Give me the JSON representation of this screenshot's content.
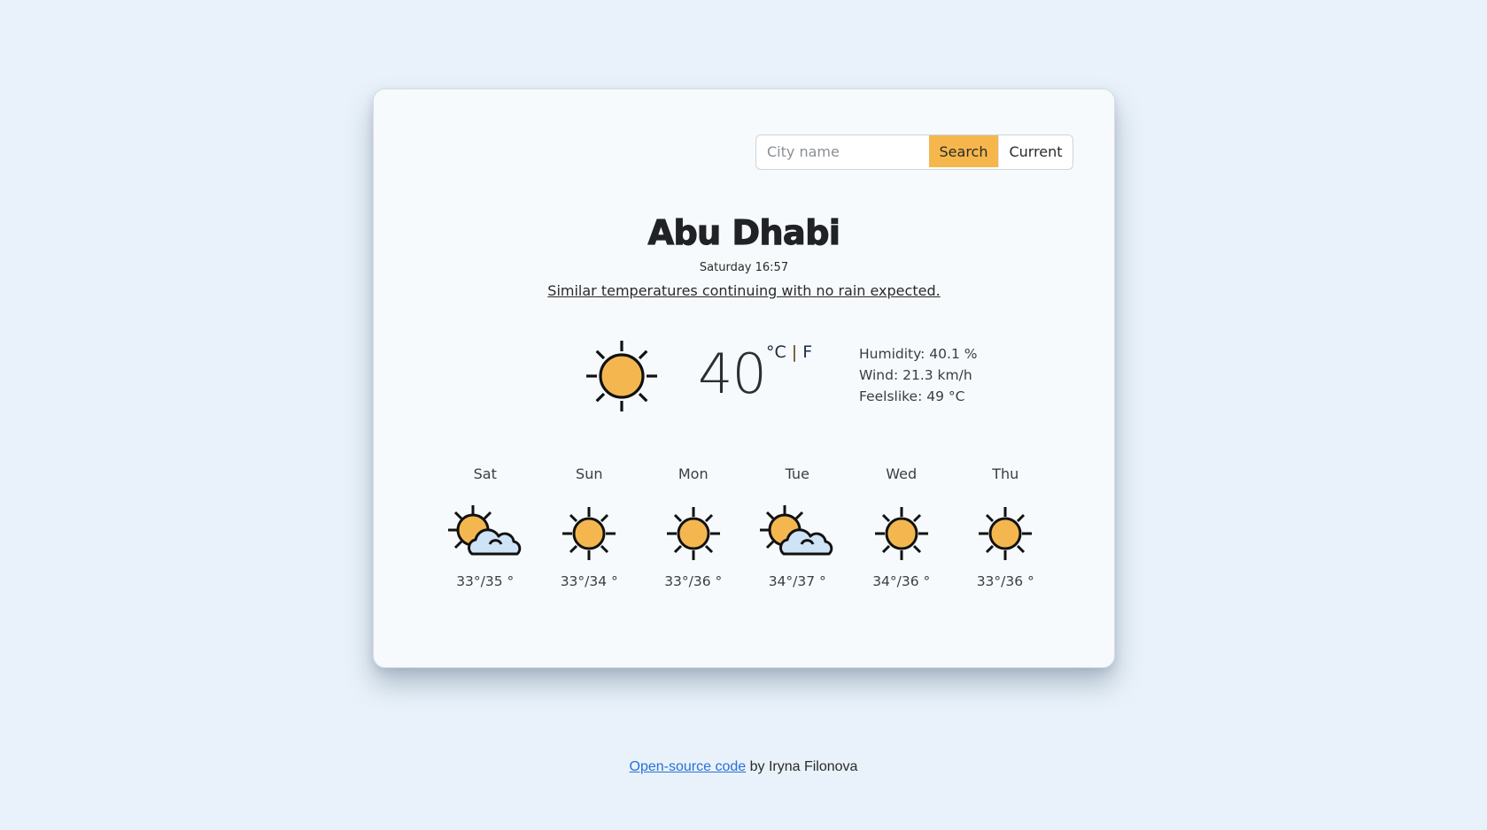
{
  "search": {
    "placeholder": "City name",
    "value": "",
    "search_label": "Search",
    "current_label": "Current"
  },
  "city": "Abu Dhabi",
  "datetime": "Saturday 16:57",
  "description": "Similar temperatures continuing with no rain expected.",
  "current": {
    "icon": "sun-icon",
    "temperature": "40",
    "unit_celsius": "°C",
    "unit_separator": "|",
    "unit_fahrenheit": "F",
    "humidity": "Humidity: 40.1 %",
    "wind": "Wind: 21.3 km/h",
    "feelslike": "Feelslike: 49 °C"
  },
  "forecast": [
    {
      "day": "Sat",
      "icon": "partly-cloudy-icon",
      "temps": "33°/35 °"
    },
    {
      "day": "Sun",
      "icon": "sun-icon",
      "temps": "33°/34 °"
    },
    {
      "day": "Mon",
      "icon": "sun-icon",
      "temps": "33°/36 °"
    },
    {
      "day": "Tue",
      "icon": "partly-cloudy-icon",
      "temps": "34°/37 °"
    },
    {
      "day": "Wed",
      "icon": "sun-icon",
      "temps": "34°/36 °"
    },
    {
      "day": "Thu",
      "icon": "sun-icon",
      "temps": "33°/36 °"
    }
  ],
  "footer": {
    "link_label": "Open-source code",
    "suffix": " by Iryna Filonova"
  },
  "colors": {
    "accent": "#f5b74c",
    "sun": "#f4b74f",
    "cloud": "#cfe3f6",
    "outline": "#111111",
    "link": "#2a6fd6",
    "background": "#e9f2fa"
  }
}
